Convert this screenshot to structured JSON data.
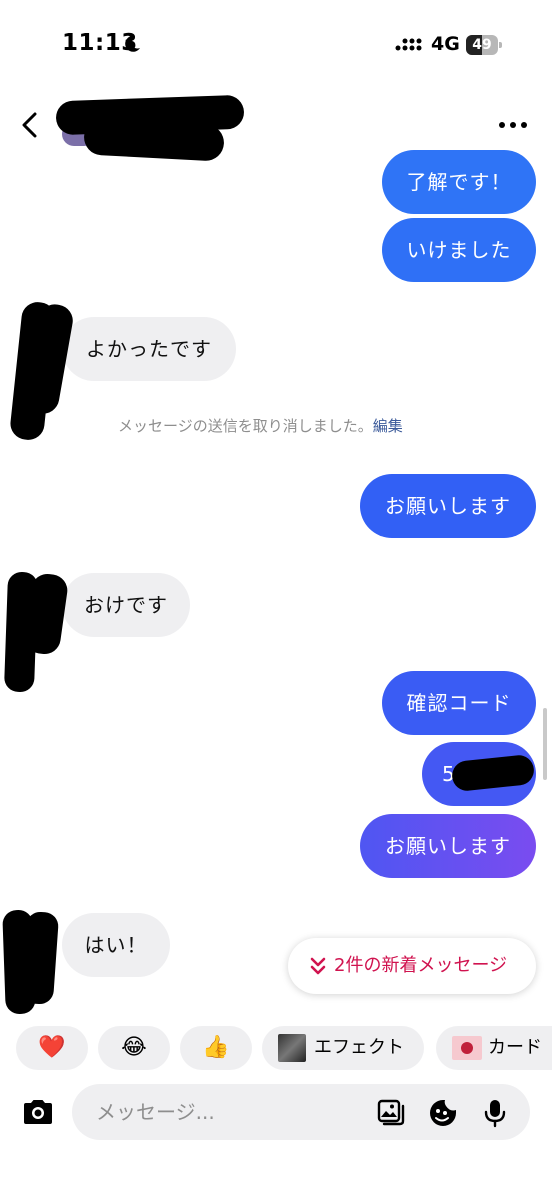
{
  "status": {
    "time": "11:13",
    "network": "4G",
    "battery": "49",
    "battery_level_percent": 49
  },
  "header": {
    "back_icon": "chevron-left-icon",
    "more_icon": "ellipsis-icon"
  },
  "messages": {
    "m1": "了解です！",
    "m2": "いけました",
    "m3": "よかったです",
    "m5": "お願いします",
    "m6": "おけです",
    "m7": "確認コード",
    "m8": "51",
    "m9": "お願いします",
    "m10": "はい！"
  },
  "system_note": {
    "text": "メッセージの送信を取り消しました。",
    "link": "編集"
  },
  "new_messages": {
    "label": "2件の新着メッセージ"
  },
  "quick_replies": {
    "heart": "❤️",
    "laugh": "😂",
    "thumbs": "👍",
    "effect": "エフェクト",
    "card": "カード"
  },
  "composer": {
    "placeholder": "メッセージ..."
  },
  "colors": {
    "sent_top": "#2f74f6",
    "sent_mid": "#3a5cf4",
    "sent_bottom": "#7a4cf0",
    "received": "#efeff1",
    "new_message_accent": "#d0134f"
  }
}
